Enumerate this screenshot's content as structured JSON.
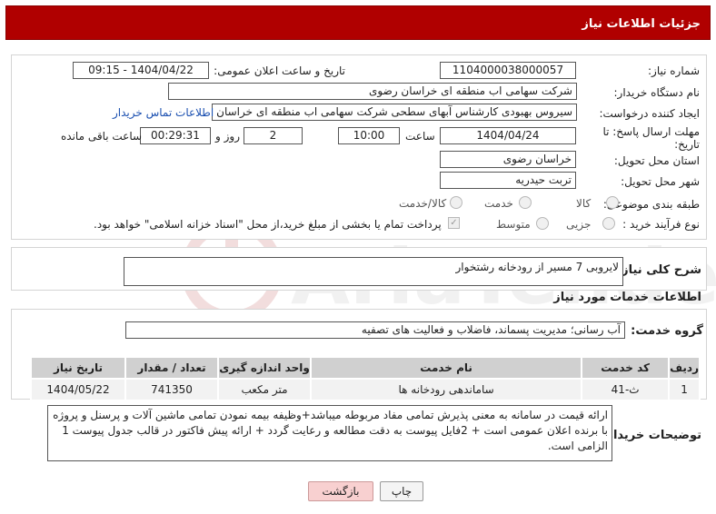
{
  "header": {
    "title": "جزئیات اطلاعات نیاز"
  },
  "form": {
    "need_number_label": "شماره نیاز:",
    "need_number": "1104000038000057",
    "announce_label": "تاریخ و ساعت اعلان عمومی:",
    "announce_value": "1404/04/22 - 09:15",
    "buyer_org_label": "نام دستگاه خریدار:",
    "buyer_org": "شرکت سهامی اب منطقه ای خراسان رضوی",
    "creator_label": "ایجاد کننده درخواست:",
    "creator": "سیروس  بهبودی کارشناس آبهای سطحی شرکت سهامی اب منطقه ای خراسان رضوی",
    "contact_link": "اطلاعات تماس خریدار",
    "deadline_label_1": "مهلت ارسال پاسخ: تا",
    "deadline_label_2": "تاریخ:",
    "deadline_date": "1404/04/24",
    "time_label": "ساعت",
    "deadline_time": "10:00",
    "days_value": "2",
    "days_label": "روز و",
    "remaining_time": "00:29:31",
    "remaining_label": "ساعت باقی مانده",
    "province_label": "استان محل تحویل:",
    "province": "خراسان رضوی",
    "city_label": "شهر محل تحویل:",
    "city": "تربت حیدریه",
    "category_label": "طبقه بندی موضوعی:",
    "category_options": [
      "کالا",
      "خدمت",
      "کالا/خدمت"
    ],
    "purchase_type_label": "نوع فرآیند خرید :",
    "purchase_type_options": [
      "جزیی",
      "متوسط"
    ],
    "payment_note": "پرداخت تمام یا بخشی از مبلغ خرید،از محل \"اسناد خزانه اسلامی\" خواهد بود."
  },
  "summary": {
    "label": "شرح کلی نیاز:",
    "value": "لایروبی 7 مسیر از رودخانه رشتخوار"
  },
  "services_section": {
    "title": "اطلاعات خدمات مورد نیاز",
    "group_label": "گروه خدمت:",
    "group_value": "آب رسانی؛ مدیریت پسماند، فاضلاب و فعالیت های تصفیه"
  },
  "table": {
    "headers": [
      "ردیف",
      "کد خدمت",
      "نام خدمت",
      "واحد اندازه گیری",
      "تعداد / مقدار",
      "تاریخ نیاز"
    ],
    "rows": [
      [
        "1",
        "ث-41",
        "ساماندهی رودخانه ها",
        "متر مکعب",
        "741350",
        "1404/05/22"
      ]
    ]
  },
  "buyer_notes": {
    "label": "توضیحات خریدار:",
    "value": "ارائه قیمت در سامانه به معنی پذیرش تمامی مفاد مربوطه میباشد+وظیفه بیمه نمودن تمامی ماشین آلات و پرسنل و پروژه با برنده اعلان عمومی است + 2فایل پیوست به دقت مطالعه و رعایت گردد + ارائه پیش فاکتور در قالب جدول پیوست 1 الزامی است."
  },
  "buttons": {
    "print": "چاپ",
    "back": "بازگشت"
  },
  "colors": {
    "header_bg": "#b00000",
    "back_btn_bg": "#f8d0d0",
    "link": "#1a4fb0"
  }
}
